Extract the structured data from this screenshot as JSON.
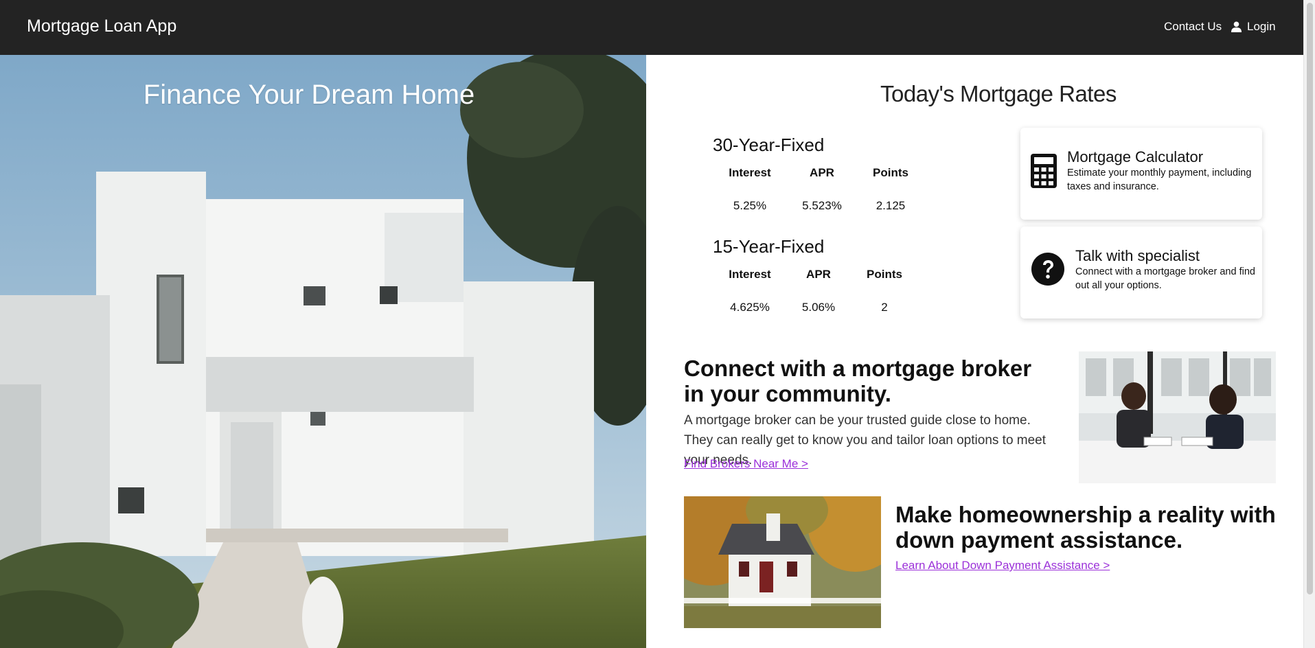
{
  "header": {
    "brand": "Mortgage Loan App",
    "contact_label": "Contact Us",
    "login_label": "Login"
  },
  "hero": {
    "title": "Finance Your Dream Home"
  },
  "rates": {
    "title": "Today's Mortgage Rates",
    "columns": [
      "Interest",
      "APR",
      "Points"
    ],
    "products": [
      {
        "name": "30-Year-Fixed",
        "values": [
          "5.25%",
          "5.523%",
          "2.125"
        ]
      },
      {
        "name": "15-Year-Fixed",
        "values": [
          "4.625%",
          "5.06%",
          "2"
        ]
      }
    ]
  },
  "cards": [
    {
      "title": "Mortgage Calculator",
      "description": "Estimate your monthly payment, including taxes and insurance.",
      "icon": "calculator-icon"
    },
    {
      "title": "Talk with specialist",
      "description": "Connect with a mortgage broker and find out all your options.",
      "icon": "question-icon"
    }
  ],
  "connect": {
    "heading": "Connect with a mortgage broker in your community.",
    "body": "A mortgage broker can be your trusted guide close to home. They can really get to know you and tailor loan options to meet your needs.",
    "link": "Find Brokers Near Me >"
  },
  "homeownership": {
    "heading": "Make homeownership a reality with down payment assistance.",
    "link": "Learn About Down Payment Assistance >"
  },
  "colors": {
    "header_bg": "#232323",
    "link": "#9b30d9"
  }
}
